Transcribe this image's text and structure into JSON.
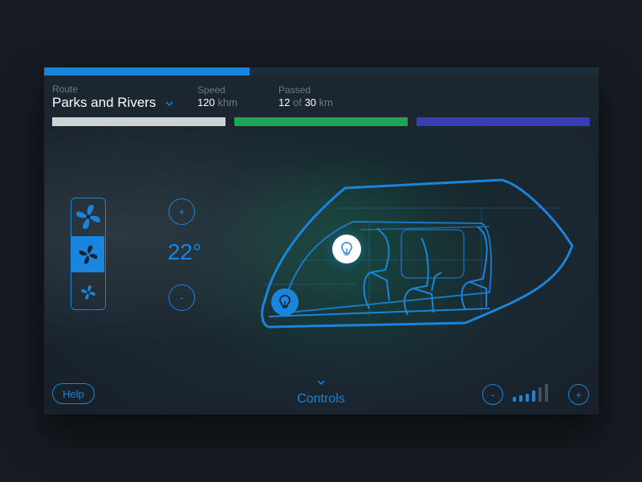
{
  "progress": {
    "value_percent": 37
  },
  "header": {
    "route_label": "Route",
    "route_value": "Parks and Rivers",
    "speed_label": "Speed",
    "speed_value": "120",
    "speed_unit": "khm",
    "passed_label": "Passed",
    "passed_current": "12",
    "passed_of": "of",
    "passed_total": "30",
    "passed_unit": "km"
  },
  "segments": [
    {
      "name": "gray",
      "color": "#cfd2d4"
    },
    {
      "name": "green",
      "color": "#1fa55a"
    },
    {
      "name": "blue",
      "color": "#3a3cb5"
    }
  ],
  "climate": {
    "temperature": "22°",
    "plus_label": "+",
    "minus_label": "-",
    "fan_speeds": [
      "high",
      "medium",
      "low"
    ],
    "fan_selected": "medium"
  },
  "footer": {
    "help_label": "Help",
    "controls_label": "Controls",
    "volume_minus": "-",
    "volume_plus": "+",
    "volume_level": 4,
    "volume_max": 6
  },
  "colors": {
    "accent": "#1a85dc",
    "background": "#161b22"
  },
  "icons": [
    "fan-icon",
    "chevron-down-icon",
    "lightbulb-icon",
    "vehicle-outline"
  ]
}
